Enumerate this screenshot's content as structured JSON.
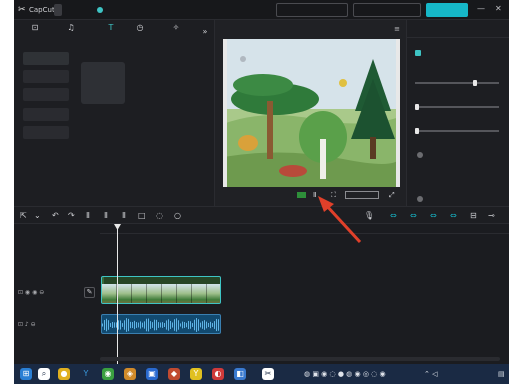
{
  "titlebar": {
    "app_name": "CapCut",
    "menu_label": "",
    "autosave_text": "",
    "center_label": "",
    "shortcuts_label": "",
    "share_label": "",
    "export_label": "",
    "minimize_glyph": "—",
    "close_glyph": "✕"
  },
  "tools": [
    {
      "label": "",
      "icon": "import-icon",
      "glyph": "⊡"
    },
    {
      "label": "",
      "icon": "audio-icon",
      "glyph": "♫"
    },
    {
      "label": "",
      "icon": "text-icon",
      "glyph": "T"
    },
    {
      "label": "",
      "icon": "sticker-icon",
      "glyph": "◷"
    },
    {
      "label": "",
      "icon": "effects-icon",
      "glyph": "✧"
    }
  ],
  "tools_more_glyph": "»",
  "sidebar": {
    "items": [
      {
        "label": ""
      },
      {
        "label": ""
      },
      {
        "label": ""
      },
      {
        "label": ""
      },
      {
        "label": ""
      }
    ]
  },
  "presets": {
    "heading": "",
    "card_label": ""
  },
  "player": {
    "heading": "",
    "menu_glyph": "≡",
    "time_current": "",
    "time_total": "",
    "play_glyph": "Ⅱ",
    "fit_glyph": "⛶",
    "ratio_label": "",
    "fullscreen_glyph": "⤢"
  },
  "props": {
    "tab_basic": "",
    "tab_voice": "",
    "section_basic": "",
    "labels": {
      "volume": "",
      "fade_in": "",
      "fade_out": ""
    },
    "values": {
      "volume": 0.72,
      "fade_in": 0.0,
      "fade_out": 0.0
    },
    "normalize_label": "",
    "normalize_note": "",
    "enhance_label": ""
  },
  "timeline": {
    "ruler_labels": [
      "",
      "",
      "",
      "",
      ""
    ],
    "clip_video_title": "",
    "track_video_icons": "⊡ ◉ ◉ ⊖",
    "track_audio_icons": "⊡ ♪ ⊖"
  },
  "taskbar": {
    "clock_time": "",
    "clock_date": "",
    "lang": ""
  },
  "colors": {
    "accent": "#16b7c8",
    "background": "#1d1e22"
  }
}
